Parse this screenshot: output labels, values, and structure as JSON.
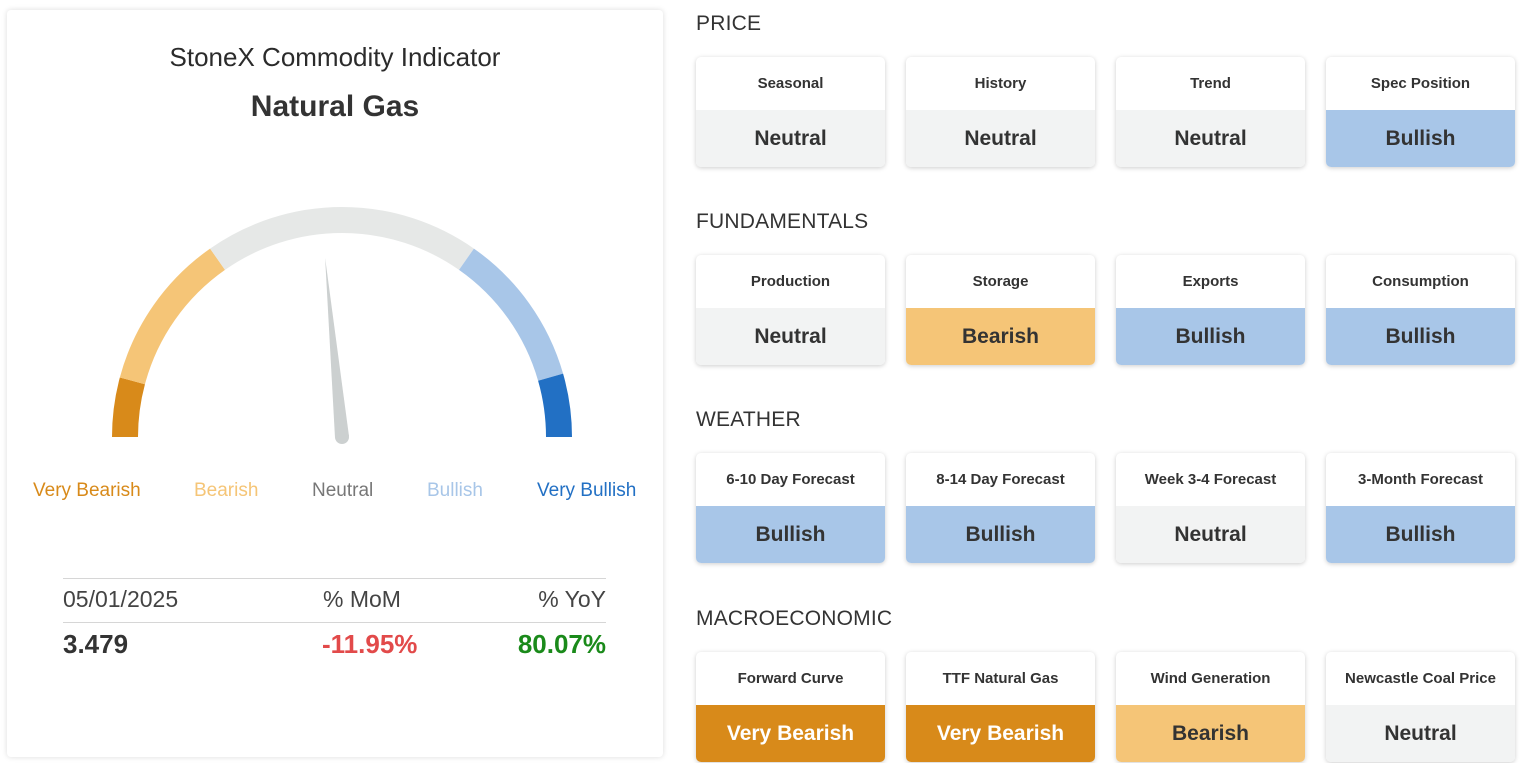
{
  "gauge_panel": {
    "title": "StoneX Commodity Indicator",
    "subtitle": "Natural Gas",
    "scale_labels": [
      "Very Bearish",
      "Bearish",
      "Neutral",
      "Bullish",
      "Very Bullish"
    ],
    "reading": "Neutral",
    "stats": {
      "date": "05/01/2025",
      "mom_label": "% MoM",
      "yoy_label": "% YoY",
      "price": "3.479",
      "mom_value": "-11.95%",
      "yoy_value": "80.07%"
    }
  },
  "colors": {
    "very_bearish": "#d88a1a",
    "bearish": "#f5c577",
    "neutral": "#f2f3f3",
    "bullish": "#a8c6e8",
    "very_bullish": "#2270c4",
    "negative": "#e24a4a",
    "positive": "#1a8a1a",
    "needle": "#ccd0d0"
  },
  "sections": [
    {
      "title": "PRICE",
      "cards": [
        {
          "label": "Seasonal",
          "status": "Neutral"
        },
        {
          "label": "History",
          "status": "Neutral"
        },
        {
          "label": "Trend",
          "status": "Neutral"
        },
        {
          "label": "Spec Position",
          "status": "Bullish"
        }
      ]
    },
    {
      "title": "FUNDAMENTALS",
      "cards": [
        {
          "label": "Production",
          "status": "Neutral"
        },
        {
          "label": "Storage",
          "status": "Bearish"
        },
        {
          "label": "Exports",
          "status": "Bullish"
        },
        {
          "label": "Consumption",
          "status": "Bullish"
        }
      ]
    },
    {
      "title": "WEATHER",
      "cards": [
        {
          "label": "6-10 Day Forecast",
          "status": "Bullish"
        },
        {
          "label": "8-14 Day Forecast",
          "status": "Bullish"
        },
        {
          "label": "Week 3-4 Forecast",
          "status": "Neutral"
        },
        {
          "label": "3-Month Forecast",
          "status": "Bullish"
        }
      ]
    },
    {
      "title": "MACROECONOMIC",
      "cards": [
        {
          "label": "Forward Curve",
          "status": "Very Bearish"
        },
        {
          "label": "TTF Natural Gas",
          "status": "Very Bearish"
        },
        {
          "label": "Wind Generation",
          "status": "Bearish"
        },
        {
          "label": "Newcastle Coal Price",
          "status": "Neutral"
        }
      ]
    }
  ]
}
